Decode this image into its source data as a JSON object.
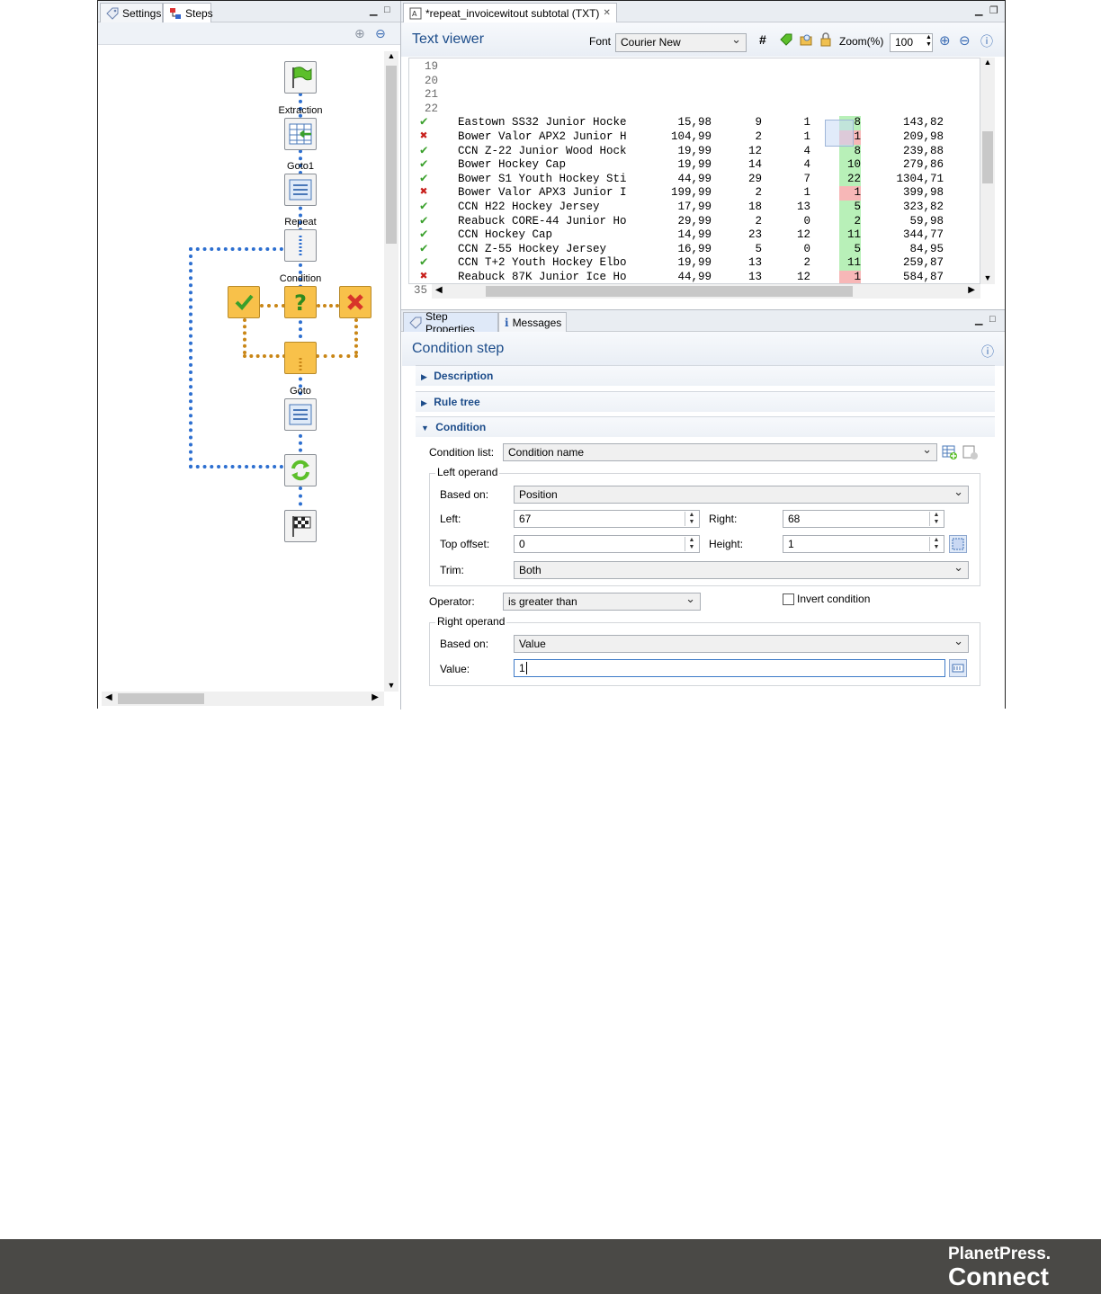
{
  "steps_panel": {
    "tabs": [
      {
        "label": "Settings"
      },
      {
        "label": "Steps"
      }
    ],
    "nodes": {
      "extraction": "Extraction",
      "goto1": "Goto1",
      "repeat": "Repeat",
      "condition": "Condition",
      "goto": "Goto"
    }
  },
  "editor": {
    "tab_title": "*repeat_invoicewitout subtotal (TXT)",
    "viewer_title": "Text viewer",
    "font_label": "Font",
    "font_value": "Courier New",
    "zoom_label": "Zoom(%)",
    "zoom_value": "100",
    "line_numbers_top": [
      "19",
      "20",
      "21",
      "22"
    ],
    "line_number_bottom": "35",
    "rows": [
      {
        "status": "pass",
        "desc": "Eastown SS32 Junior Hocke",
        "price": "15,98",
        "qty": "9",
        "back": "1",
        "col": "8",
        "total": "143,82"
      },
      {
        "status": "fail",
        "desc": "Bower Valor APX2 Junior H",
        "price": "104,99",
        "qty": "2",
        "back": "1",
        "col": "1",
        "total": "209,98"
      },
      {
        "status": "pass",
        "desc": "CCN Z-22 Junior Wood Hock",
        "price": "19,99",
        "qty": "12",
        "back": "4",
        "col": "8",
        "total": "239,88"
      },
      {
        "status": "pass",
        "desc": "Bower Hockey Cap",
        "price": "19,99",
        "qty": "14",
        "back": "4",
        "col": "10",
        "total": "279,86"
      },
      {
        "status": "pass",
        "desc": "Bower S1 Youth Hockey Sti",
        "price": "44,99",
        "qty": "29",
        "back": "7",
        "col": "22",
        "total": "1304,71"
      },
      {
        "status": "fail",
        "desc": "Bower Valor APX3 Junior I",
        "price": "199,99",
        "qty": "2",
        "back": "1",
        "col": "1",
        "total": "399,98"
      },
      {
        "status": "pass",
        "desc": "CCN H22 Hockey Jersey",
        "price": "17,99",
        "qty": "18",
        "back": "13",
        "col": "5",
        "total": "323,82"
      },
      {
        "status": "pass",
        "desc": "Reabuck CORE-44 Junior Ho",
        "price": "29,99",
        "qty": "2",
        "back": "0",
        "col": "2",
        "total": "59,98"
      },
      {
        "status": "pass",
        "desc": "CCN Hockey Cap",
        "price": "14,99",
        "qty": "23",
        "back": "12",
        "col": "11",
        "total": "344,77"
      },
      {
        "status": "pass",
        "desc": "CCN Z-55 Hockey Jersey",
        "price": "16,99",
        "qty": "5",
        "back": "0",
        "col": "5",
        "total": "84,95"
      },
      {
        "status": "pass",
        "desc": "CCN T+2 Youth Hockey Elbo",
        "price": "19,99",
        "qty": "13",
        "back": "2",
        "col": "11",
        "total": "259,87"
      },
      {
        "status": "fail",
        "desc": "Reabuck 87K Junior Ice Ho",
        "price": "44,99",
        "qty": "13",
        "back": "12",
        "col": "1",
        "total": "584,87"
      }
    ]
  },
  "properties": {
    "tabs": [
      {
        "label": "Step Properties"
      },
      {
        "label": "Messages"
      }
    ],
    "title": "Condition step",
    "sections": {
      "description": "Description",
      "rule_tree": "Rule tree",
      "condition": "Condition"
    },
    "condition_list_label": "Condition list:",
    "condition_list_value": "Condition name",
    "left_operand": {
      "title": "Left operand",
      "based_on_label": "Based on:",
      "based_on_value": "Position",
      "left_label": "Left:",
      "left_value": "67",
      "right_label": "Right:",
      "right_value": "68",
      "top_offset_label": "Top offset:",
      "top_offset_value": "0",
      "height_label": "Height:",
      "height_value": "1",
      "trim_label": "Trim:",
      "trim_value": "Both"
    },
    "operator_label": "Operator:",
    "operator_value": "is greater than",
    "invert_label": "Invert condition",
    "right_operand": {
      "title": "Right operand",
      "based_on_label": "Based on:",
      "based_on_value": "Value",
      "value_label": "Value:",
      "value_value": "1"
    }
  },
  "brand": {
    "line1": "PlanetPress.",
    "line2": "Connect"
  },
  "colors": {
    "pass": "#3aa02c",
    "fail": "#c8201c",
    "footer": "#4a4946",
    "accent": "#1c4c8a"
  }
}
